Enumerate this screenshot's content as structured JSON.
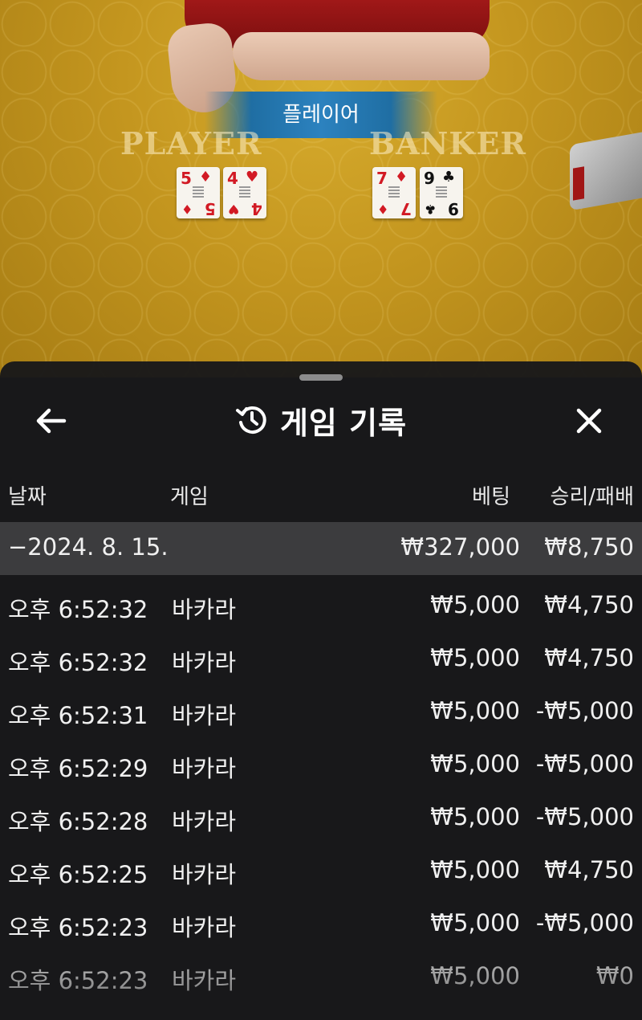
{
  "table": {
    "result_banner": "플레이어",
    "player_label": "PLAYER",
    "banker_label": "BANKER",
    "player_cards": [
      {
        "rank": "5",
        "suit": "♦",
        "color": "red"
      },
      {
        "rank": "4",
        "suit": "♥",
        "color": "red"
      }
    ],
    "banker_cards": [
      {
        "rank": "7",
        "suit": "♦",
        "color": "red"
      },
      {
        "rank": "9",
        "suit": "♣",
        "color": "black"
      }
    ]
  },
  "sheet": {
    "title": "게임 기록",
    "title_icon": "history-icon",
    "back_icon": "arrow-left-icon",
    "close_icon": "close-icon",
    "columns": {
      "date": "날짜",
      "game": "게임",
      "bet": "베팅",
      "result": "승리/패배"
    },
    "date_row": {
      "date": "−2024. 8. 15.",
      "bet_total": "₩327,000",
      "result_total": "₩8,750"
    },
    "rows": [
      {
        "time": "오후 6:52:32",
        "game": "바카라",
        "bet": "₩5,000",
        "result": "₩4,750"
      },
      {
        "time": "오후 6:52:32",
        "game": "바카라",
        "bet": "₩5,000",
        "result": "₩4,750"
      },
      {
        "time": "오후 6:52:31",
        "game": "바카라",
        "bet": "₩5,000",
        "result": "-₩5,000"
      },
      {
        "time": "오후 6:52:29",
        "game": "바카라",
        "bet": "₩5,000",
        "result": "-₩5,000"
      },
      {
        "time": "오후 6:52:28",
        "game": "바카라",
        "bet": "₩5,000",
        "result": "-₩5,000"
      },
      {
        "time": "오후 6:52:25",
        "game": "바카라",
        "bet": "₩5,000",
        "result": "₩4,750"
      },
      {
        "time": "오후 6:52:23",
        "game": "바카라",
        "bet": "₩5,000",
        "result": "-₩5,000"
      },
      {
        "time": "오후 6:52:23",
        "game": "바카라",
        "bet": "₩5,000",
        "result": "₩0"
      }
    ]
  },
  "colors": {
    "felt": "#c4961f",
    "banner": "#2c82bf",
    "sheet_bg": "#18181a",
    "date_row_bg": "#3c3c3e"
  }
}
